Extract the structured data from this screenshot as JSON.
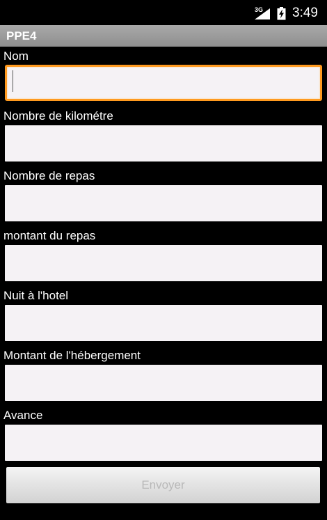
{
  "status_bar": {
    "network_type": "3G",
    "time": "3:49",
    "icons": [
      "signal-icon",
      "battery-charging-icon"
    ]
  },
  "app": {
    "title": "PPE4"
  },
  "form": {
    "fields": [
      {
        "label": "Nom",
        "value": "",
        "placeholder": ""
      },
      {
        "label": "Nombre de kilométre",
        "value": "",
        "placeholder": ""
      },
      {
        "label": "Nombre de repas",
        "value": "",
        "placeholder": ""
      },
      {
        "label": "montant du repas",
        "value": "",
        "placeholder": ""
      },
      {
        "label": "Nuit à l'hotel",
        "value": "",
        "placeholder": ""
      },
      {
        "label": "Montant de l'hébergement",
        "value": "",
        "placeholder": ""
      },
      {
        "label": "Avance",
        "value": "",
        "placeholder": ""
      }
    ],
    "submit_label": "Envoyer"
  },
  "colors": {
    "background": "#000000",
    "title_bar": "#a0a0a0",
    "input_background": "#f5f2f5",
    "focus_border": "#ff9a1f",
    "button_text_disabled": "#b8b8b8"
  }
}
